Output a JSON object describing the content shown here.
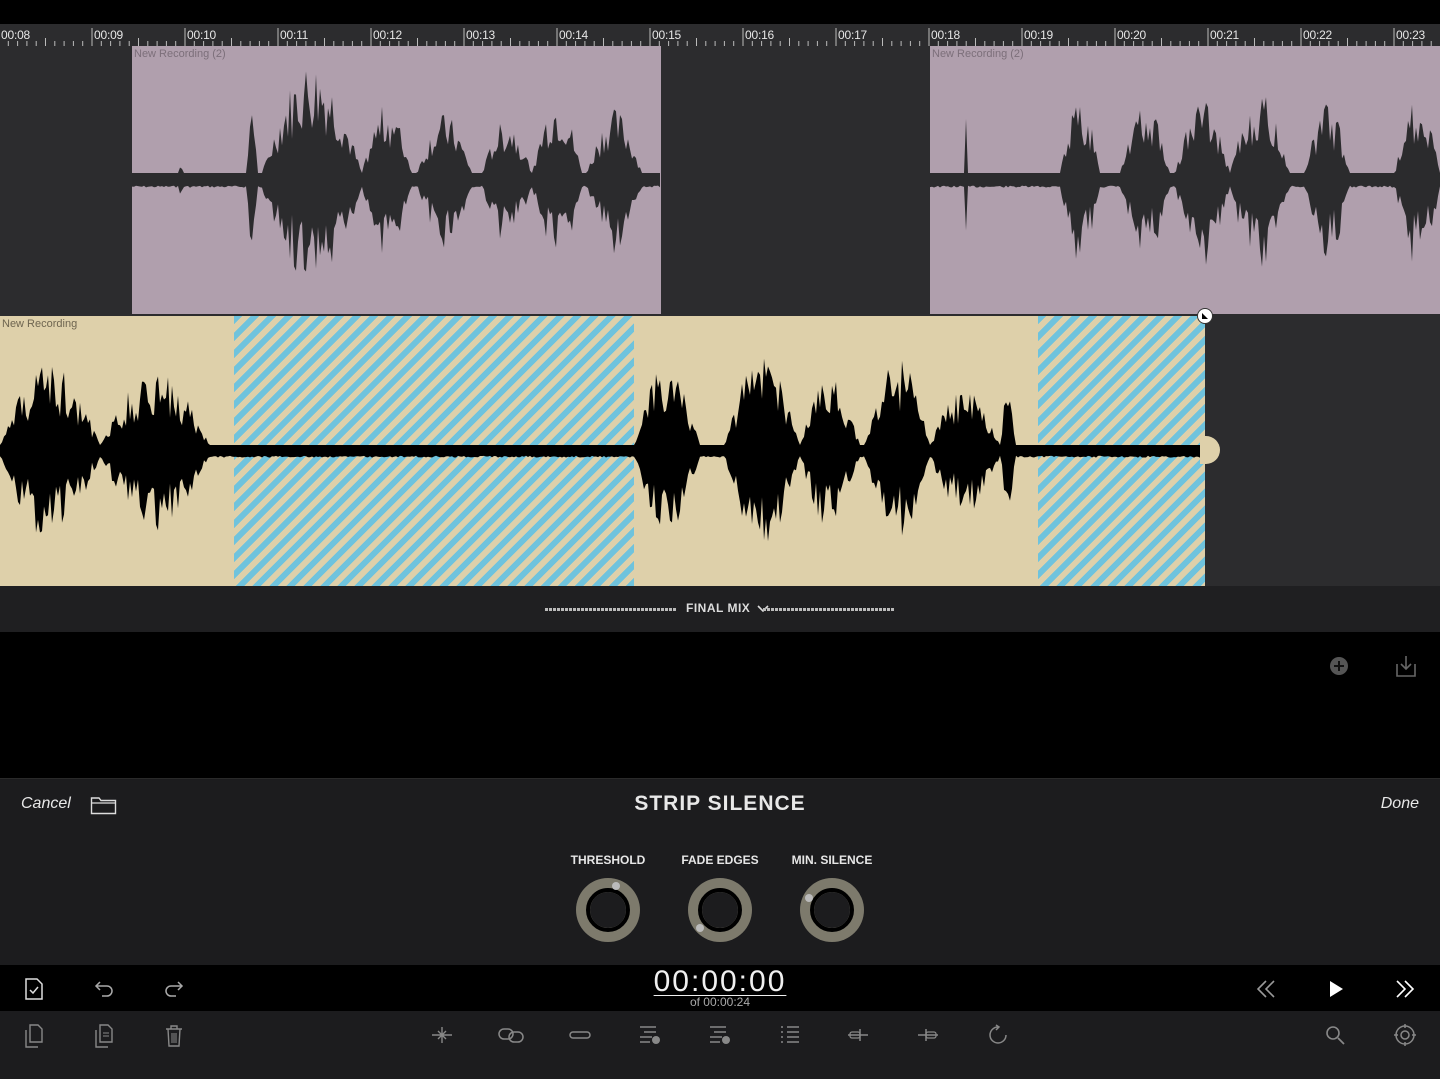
{
  "ruler": {
    "labels": [
      "00:08",
      "00:09",
      "00:10",
      "00:11",
      "00:12",
      "00:13",
      "00:14",
      "00:15",
      "00:16",
      "00:17",
      "00:18",
      "00:19",
      "00:20",
      "00:21",
      "00:22",
      "00:23"
    ]
  },
  "tracks": {
    "top_clip_1_name": "New Recording (2)",
    "top_clip_2_name": "New Recording (2)",
    "bottom_clip_name": "New Recording"
  },
  "mix": {
    "label": "FINAL MIX"
  },
  "panel": {
    "title": "STRIP SILENCE",
    "cancel_label": "Cancel",
    "done_label": "Done",
    "knobs": [
      {
        "label": "THRESHOLD"
      },
      {
        "label": "FADE EDGES"
      },
      {
        "label": "MIN. SILENCE"
      }
    ]
  },
  "transport": {
    "timecode": "00:00:00",
    "total": "of 00:00:24"
  },
  "colors": {
    "top_clip": "#b09fad",
    "bottom_clip": "#ded0aa",
    "silence_hatch": "#6fc3dd",
    "background": "#2c2c2e"
  }
}
